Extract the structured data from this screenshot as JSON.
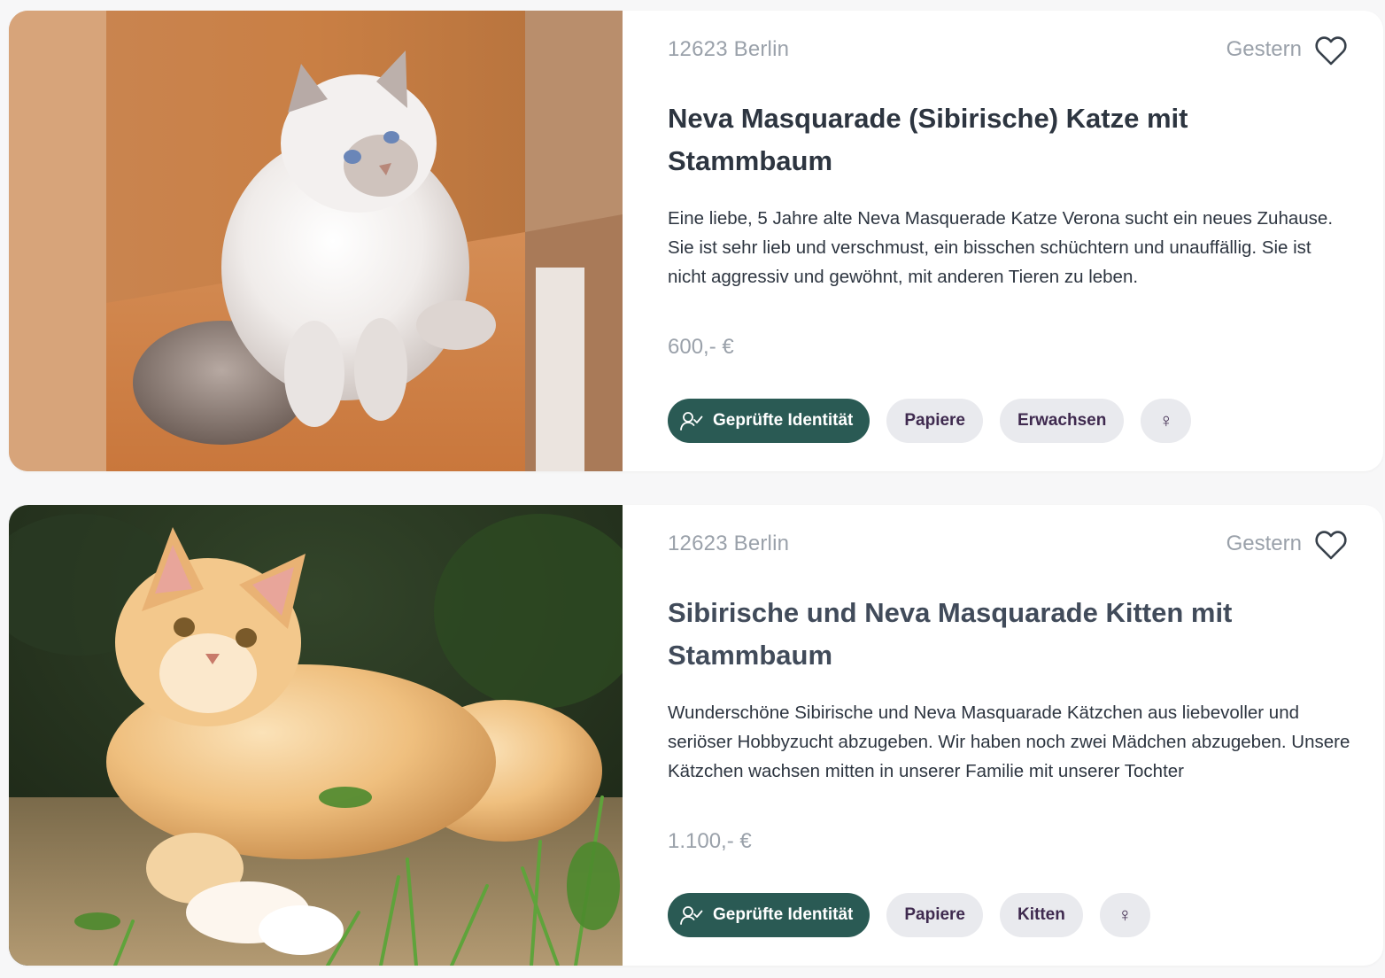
{
  "listings": [
    {
      "location": "12623 Berlin",
      "date": "Gestern",
      "title": "Neva Masquarade (Sibirische) Katze mit Stammbaum",
      "description": "Eine liebe, 5 Jahre alte Neva Masquerade Katze Verona sucht ein neues Zuhause. Sie ist sehr lieb und verschmust, ein bisschen schüchtern und unauffällig. Sie ist nicht aggressiv und gewöhnt, mit anderen Tieren zu leben.",
      "price": "600,- €",
      "tags": {
        "verified": "Geprüfte Identität",
        "papers": "Papiere",
        "age": "Erwachsen",
        "sex": "♀"
      },
      "image": "white fluffy cat sitting against orange wall"
    },
    {
      "location": "12623 Berlin",
      "date": "Gestern",
      "title": "Sibirische und Neva Masquarade Kitten mit Stammbaum",
      "description": "Wunderschöne Sibirische und Neva Masquarade Kätzchen aus liebevoller und seriöser Hobbyzucht abzugeben. Wir haben noch zwei Mädchen abzugeben. Unsere Kätzchen wachsen mitten in unserer Familie mit unserer Tochter",
      "price": "1.100,- €",
      "tags": {
        "verified": "Geprüfte Identität",
        "papers": "Papiere",
        "age": "Kitten",
        "sex": "♀"
      },
      "image": "orange fluffy kitten lying in grass"
    }
  ],
  "colors": {
    "verified_bg": "#2a5a54",
    "tag_bg": "#e9eaee",
    "tag_text": "#3f2a4f",
    "muted_text": "#9aa1aa",
    "title_text": "#2d3540"
  },
  "icons": [
    "heart-icon",
    "verified-user-icon",
    "female-icon"
  ]
}
